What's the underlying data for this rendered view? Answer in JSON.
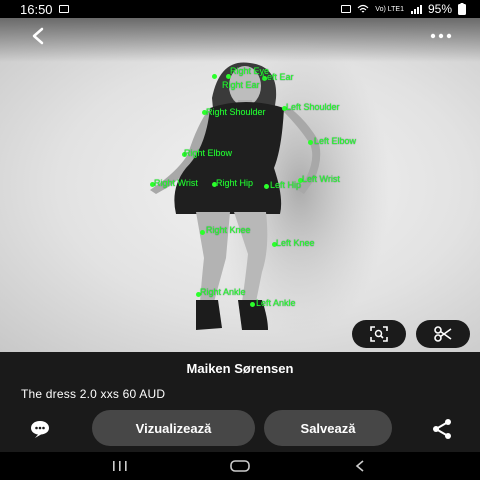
{
  "status_bar": {
    "time": "16:50",
    "battery": "95%",
    "signal_text": "Vo) LTE1"
  },
  "header": {
    "back_icon": "chevron-left-icon",
    "more_icon": "more-horizontal-icon"
  },
  "keypoints": [
    {
      "label": "Right Eye"
    },
    {
      "label": "Right Ear"
    },
    {
      "label": "Left Ear"
    },
    {
      "label": "Right Shoulder"
    },
    {
      "label": "Left Shoulder"
    },
    {
      "label": "Right Elbow"
    },
    {
      "label": "Left Elbow"
    },
    {
      "label": "Right Wrist"
    },
    {
      "label": "Right Hip"
    },
    {
      "label": "Left Hip"
    },
    {
      "label": "Left Wrist"
    },
    {
      "label": "Right Knee"
    },
    {
      "label": "Left Knee"
    },
    {
      "label": "Right Ankle"
    },
    {
      "label": "Left Ankle"
    }
  ],
  "overlay_buttons": {
    "lens_icon": "visual-search-icon",
    "cut_icon": "scissors-icon"
  },
  "info": {
    "person_name": "Maiken Sørensen",
    "caption": "The dress 2.0 xxs 60 AUD",
    "visualize_label": "Vizualizează",
    "save_label": "Salvează"
  },
  "nav": {
    "recents_icon": "recents-icon",
    "home_icon": "home-icon",
    "back_icon": "back-icon"
  },
  "colors": {
    "keypoint": "#2bff2b",
    "panel": "#1a1a1a",
    "pill": "#474747"
  }
}
